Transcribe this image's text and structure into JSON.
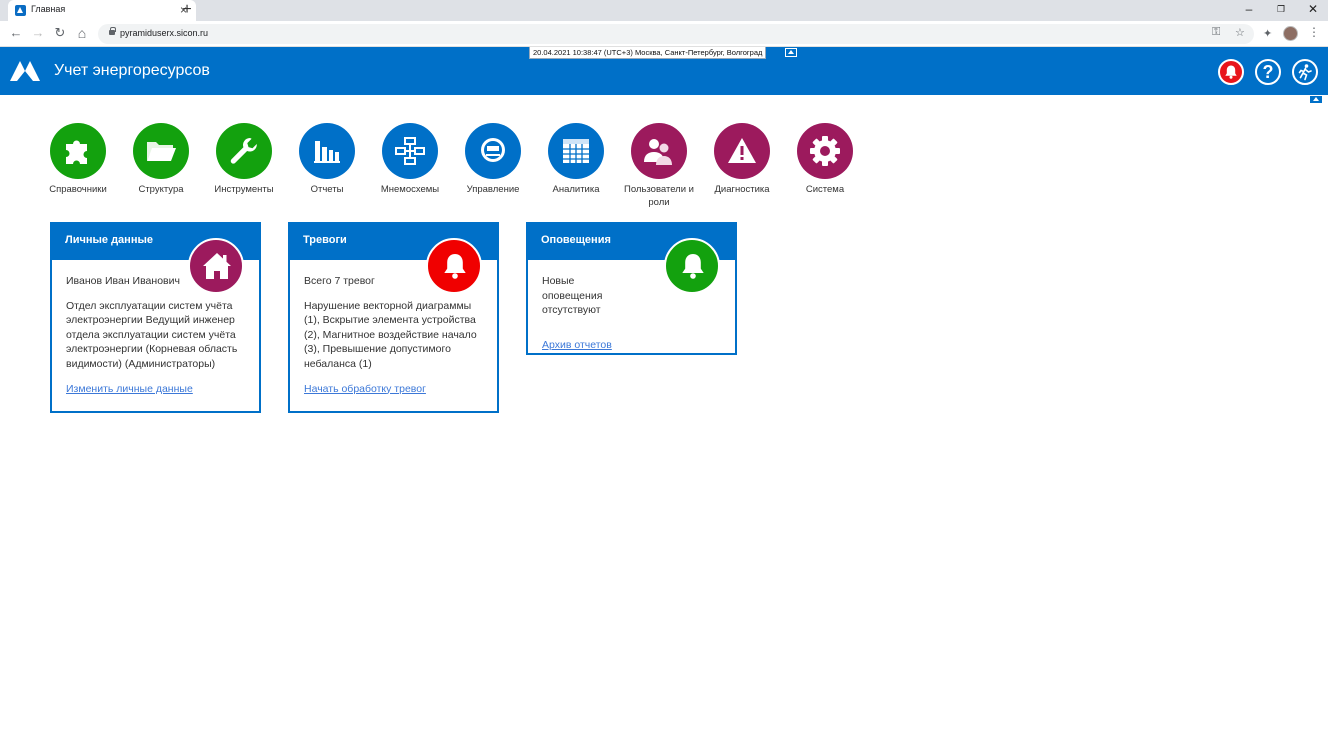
{
  "browser": {
    "tab_title": "Главная",
    "tab_close": "×",
    "new_tab": "+",
    "url": "pyramiduserx.sicon.ru",
    "window": {
      "minimize": "–",
      "restore": "❐",
      "close": "✕"
    },
    "nav": {
      "back": "←",
      "forward": "→",
      "reload": "↻",
      "home": "⌂"
    },
    "menu": "⋮"
  },
  "header": {
    "title": "Учет энергоресурсов",
    "datetime": "20.04.2021 10:38:47 (UTC+3) Москва, Санкт-Петербург, Волгоград",
    "help_label": "?",
    "colors": {
      "bar": "#0070c8",
      "alarm": "#e8151b"
    }
  },
  "modules": [
    {
      "label": "Справочники",
      "icon": "puzzle-icon",
      "color": "#13a10e"
    },
    {
      "label": "Структура",
      "icon": "folder-icon",
      "color": "#13a10e"
    },
    {
      "label": "Инструменты",
      "icon": "wrench-icon",
      "color": "#13a10e"
    },
    {
      "label": "Отчеты",
      "icon": "bar-chart-icon",
      "color": "#0070c8"
    },
    {
      "label": "Мнемосхемы",
      "icon": "schema-icon",
      "color": "#0070c8"
    },
    {
      "label": "Управление",
      "icon": "meter-icon",
      "color": "#0070c8"
    },
    {
      "label": "Аналитика",
      "icon": "table-icon",
      "color": "#0070c8"
    },
    {
      "label": "Пользователи и роли",
      "icon": "users-icon",
      "color": "#9c1a5d"
    },
    {
      "label": "Диагностика",
      "icon": "warning-icon",
      "color": "#9c1a5d"
    },
    {
      "label": "Система",
      "icon": "gear-icon",
      "color": "#9c1a5d"
    }
  ],
  "cards": {
    "personal": {
      "title": "Личные данные",
      "name": "Иванов Иван Иванович",
      "details": "Отдел эксплуатации систем учёта электроэнергии Ведущий инженер отдела эксплуатации систем учёта электроэнергии (Корневая область видимости) (Администраторы)",
      "link": "Изменить личные данные",
      "badge_color": "#9c1a5d"
    },
    "alarms": {
      "title": "Тревоги",
      "count_text": "Всего 7 тревог",
      "details": "Нарушение векторной диаграммы (1), Вскрытие элемента устройства (2), Магнитное воздействие начало (3), Превышение допустимого небаланса (1)",
      "link": "Начать обработку тревог",
      "badge_color": "#f00000"
    },
    "notifications": {
      "title": "Оповещения",
      "text": "Новые оповещения отсутствуют",
      "link": "Архив отчетов",
      "badge_color": "#13a10e"
    }
  }
}
